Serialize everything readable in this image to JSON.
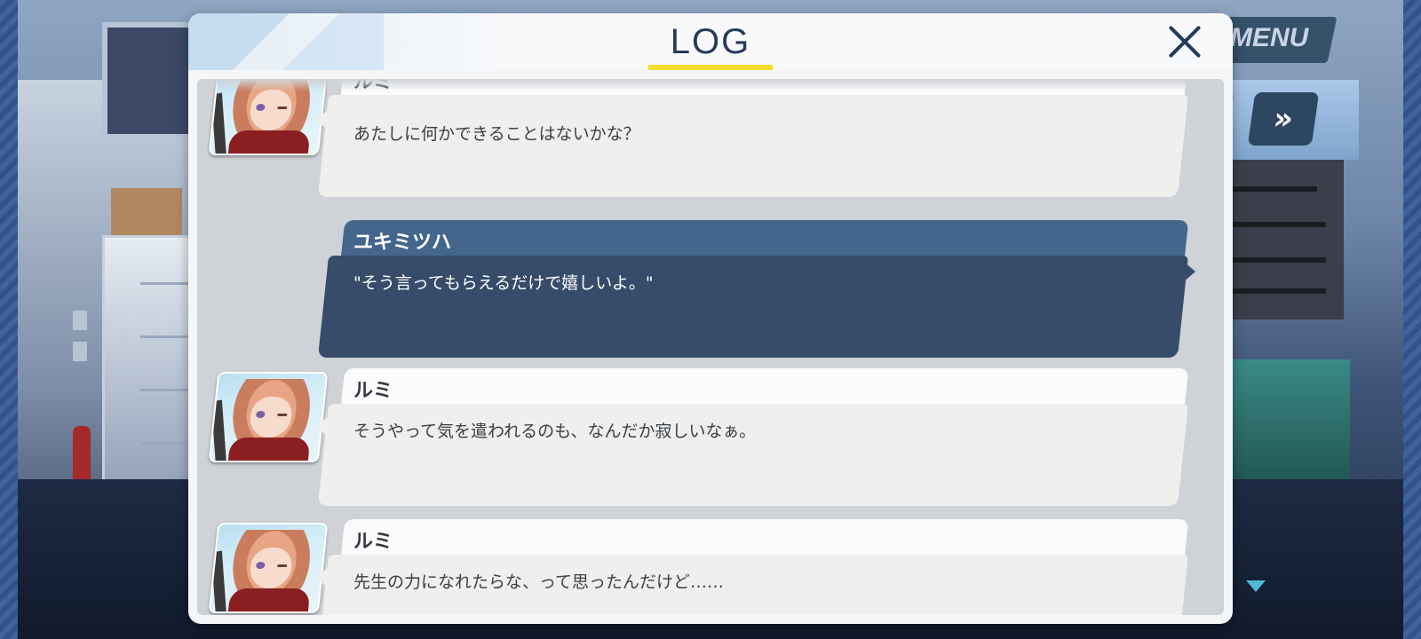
{
  "hud": {
    "menu_label": "MENU",
    "fast_forward_icon": "»"
  },
  "log": {
    "title": "LOG",
    "entries": [
      {
        "speaker": "ルミ",
        "text": "あたしに何かできることはないかな？"
      },
      {
        "speaker": "ユキミツハ",
        "text": "\"そう言ってもらえるだけで嬉しいよ。\""
      },
      {
        "speaker": "ルミ",
        "text": "そうやって気を遣われるのも、なんだか寂しいなぁ。"
      },
      {
        "speaker": "ルミ",
        "text": "先生の力になれたらな、って思ったんだけど……"
      }
    ]
  },
  "colors": {
    "title_underline": "#f6dd2b",
    "player_bubble": "#364c6a",
    "player_namebar": "#44668d",
    "npc_bubble": "#efefed"
  }
}
